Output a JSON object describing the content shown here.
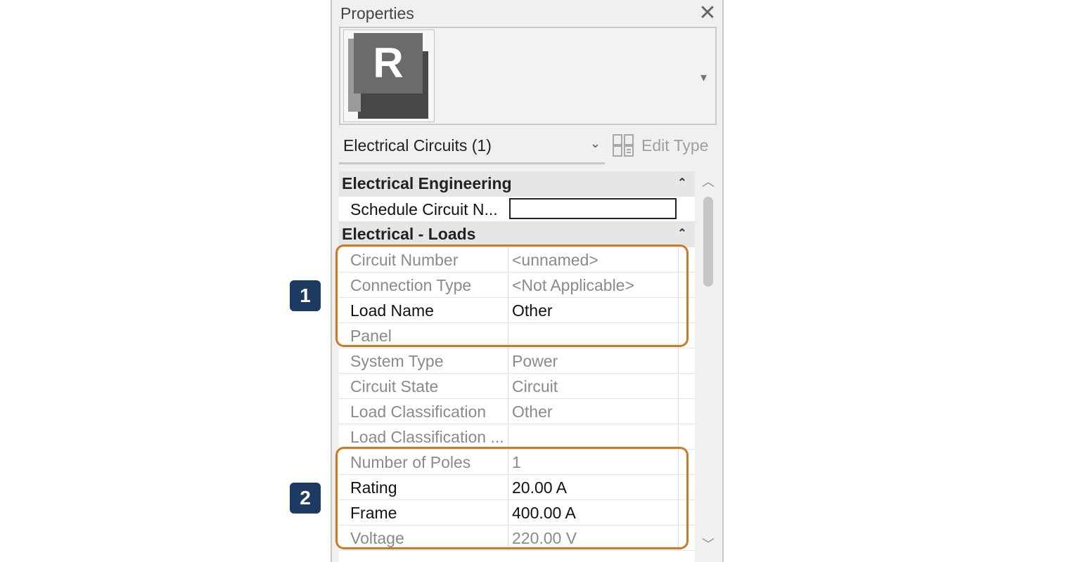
{
  "panel": {
    "title": "Properties",
    "close_glyph": "✕",
    "logo_letter": "R",
    "preview_arrow": "▾",
    "type_selector": {
      "label": "Electrical Circuits (1)",
      "chevron": "⌄"
    },
    "edit_type_label": "Edit Type",
    "groups": [
      {
        "label": "Electrical Engineering",
        "collapse_glyph": "⌃",
        "rows": [
          {
            "name": "Schedule Circuit N...",
            "value": "",
            "editable": true
          }
        ]
      },
      {
        "label": "Electrical - Loads",
        "collapse_glyph": "⌃",
        "rows": [
          {
            "name": "Circuit Number",
            "value": "<unnamed>",
            "dim": true
          },
          {
            "name": "Connection Type",
            "value": "<Not Applicable>",
            "dim": true
          },
          {
            "name": "Load Name",
            "value": "Other",
            "dim": false
          },
          {
            "name": "Panel",
            "value": "",
            "dim": true
          },
          {
            "name": "System Type",
            "value": "Power",
            "dim": true
          },
          {
            "name": "Circuit State",
            "value": "Circuit",
            "dim": true
          },
          {
            "name": "Load Classification",
            "value": "Other",
            "dim": true
          },
          {
            "name": "Load Classification ...",
            "value": "",
            "dim": true
          },
          {
            "name": "Number of Poles",
            "value": "1",
            "dim": true
          },
          {
            "name": "Rating",
            "value": "20.00 A",
            "dim": false
          },
          {
            "name": "Frame",
            "value": "400.00 A",
            "dim": false
          },
          {
            "name": "Voltage",
            "value": "220.00 V",
            "dim": true
          }
        ]
      }
    ]
  },
  "callouts": [
    {
      "label": "1"
    },
    {
      "label": "2"
    }
  ],
  "colors": {
    "highlight": "#c87d24",
    "badge": "#1d3a63",
    "dim_text": "#8a8a8a"
  }
}
